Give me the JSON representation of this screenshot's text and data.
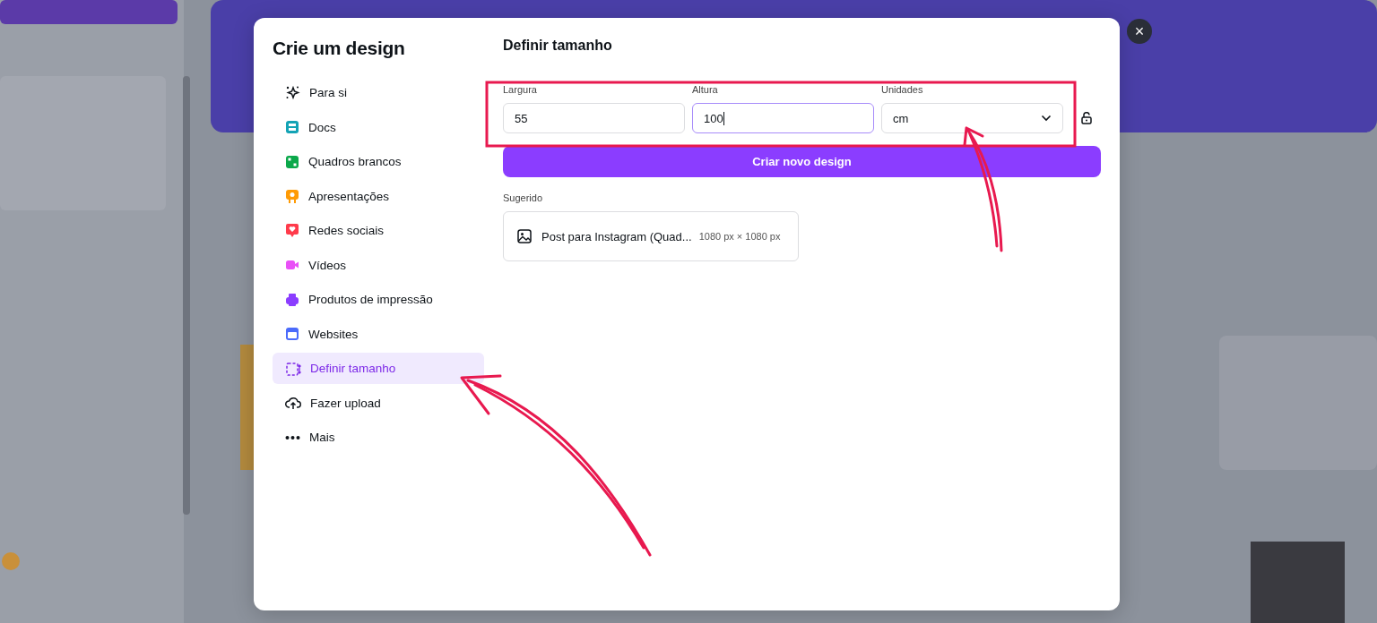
{
  "dialog": {
    "title": "Crie um design",
    "close": "×"
  },
  "sidebar": {
    "items": [
      {
        "label": "Para si",
        "selected": false
      },
      {
        "label": "Docs",
        "selected": false
      },
      {
        "label": "Quadros brancos",
        "selected": false
      },
      {
        "label": "Apresentações",
        "selected": false
      },
      {
        "label": "Redes sociais",
        "selected": false
      },
      {
        "label": "Vídeos",
        "selected": false
      },
      {
        "label": "Produtos de impressão",
        "selected": false
      },
      {
        "label": "Websites",
        "selected": false
      },
      {
        "label": "Definir tamanho",
        "selected": true
      },
      {
        "label": "Fazer upload",
        "selected": false
      },
      {
        "label": "Mais",
        "selected": false
      }
    ]
  },
  "panel": {
    "title": "Definir tamanho",
    "fields": [
      {
        "label": "Largura",
        "value": "55",
        "focused": false
      },
      {
        "label": "Altura",
        "value": "100",
        "focused": true
      }
    ],
    "units": {
      "label": "Unidades",
      "value": "cm"
    },
    "create_button": "Criar novo design",
    "suggested": {
      "heading": "Sugerido",
      "items": [
        {
          "name": "Post para Instagram (Quad...",
          "size": "1080 px × 1080 px"
        }
      ]
    }
  }
}
